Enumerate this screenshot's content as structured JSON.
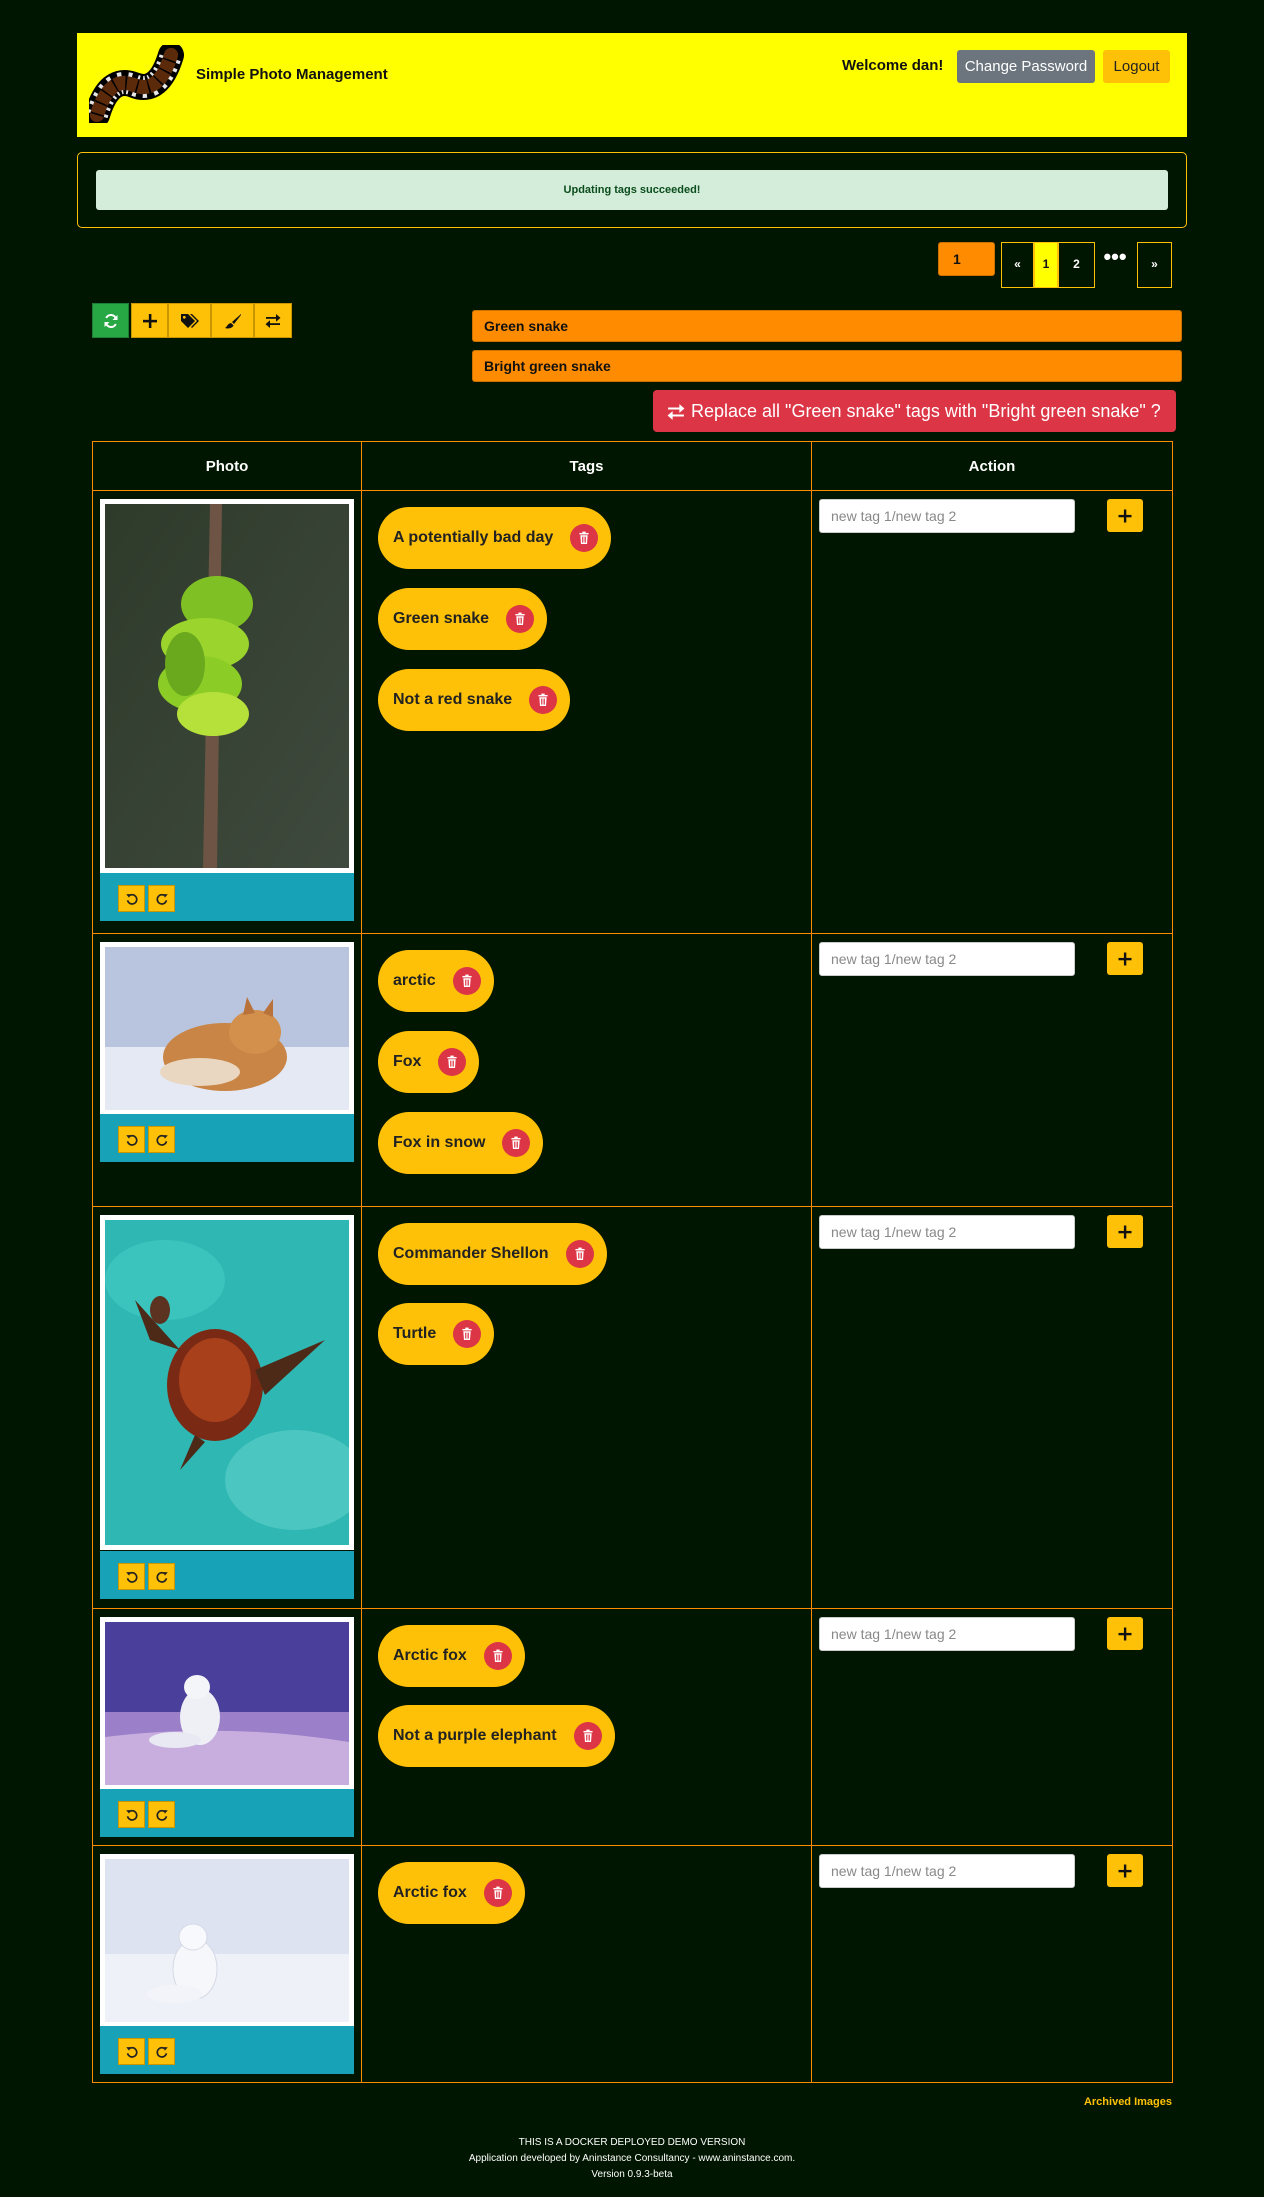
{
  "header": {
    "app_title": "Simple Photo Management",
    "welcome": "Welcome dan!",
    "change_password": "Change Password",
    "logout": "Logout"
  },
  "alert": {
    "message": "Updating tags succeeded!"
  },
  "pagination": {
    "current_page_value": "1",
    "prev": "«",
    "pages": [
      "1",
      "2"
    ],
    "active_page": "1",
    "ellipsis": "•••",
    "next": "»"
  },
  "toolbar": {
    "buttons": [
      "refresh-icon",
      "plus-icon",
      "tags-icon",
      "brush-icon",
      "exchange-icon"
    ]
  },
  "tag_replace": {
    "from_tag": "Green snake",
    "to_tag": "Bright green snake",
    "button_label": "Replace all \"Green snake\" tags with \"Bright green snake\" ?"
  },
  "table": {
    "headers": [
      "Photo",
      "Tags",
      "Action"
    ],
    "input_placeholder": "new tag 1/new tag 2",
    "rows": [
      {
        "photo": "green snake coiled on branch",
        "tags": [
          "A potentially bad day",
          "Green snake",
          "Not a red snake"
        ]
      },
      {
        "photo": "fox sleeping in snow",
        "tags": [
          "arctic",
          "Fox",
          "Fox in snow"
        ]
      },
      {
        "photo": "sea turtle swimming",
        "tags": [
          "Commander Shellon",
          "Turtle"
        ]
      },
      {
        "photo": "arctic fox on purple snow",
        "tags": [
          "Arctic fox",
          "Not a purple elephant"
        ]
      },
      {
        "photo": "white arctic fox in snow",
        "tags": [
          "Arctic fox"
        ]
      }
    ]
  },
  "archived_link": "Archived Images",
  "footer": {
    "line1": "THIS IS A DOCKER DEPLOYED DEMO VERSION",
    "line2": "Application developed by Aninstance Consultancy - www.aninstance.com.",
    "line3": "Version 0.9.3-beta"
  },
  "colors": {
    "background": "#011601",
    "header": "#ffff00",
    "accent": "#ffc107",
    "orange": "#ff8c00",
    "danger": "#dc3545",
    "teal": "#17a2b8"
  }
}
